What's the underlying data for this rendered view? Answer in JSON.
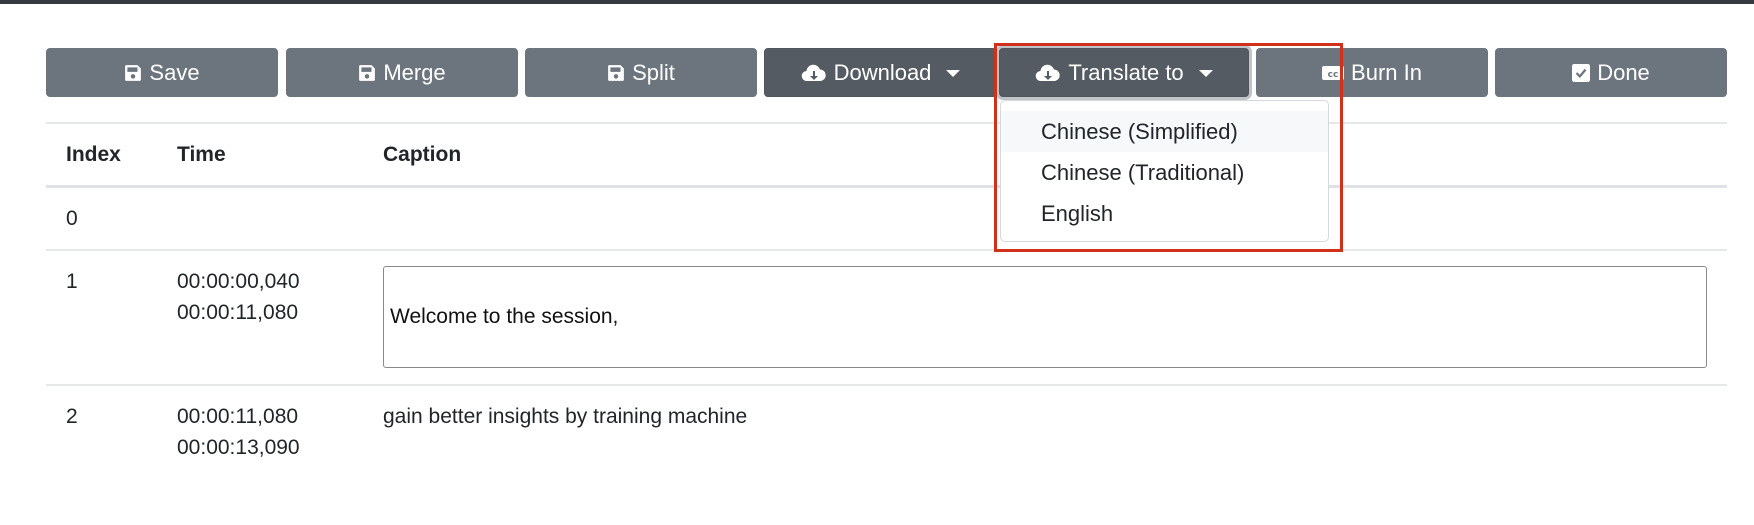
{
  "toolbar": {
    "buttons": [
      {
        "label": "Save",
        "icon": "save-icon"
      },
      {
        "label": "Merge",
        "icon": "save-icon"
      },
      {
        "label": "Split",
        "icon": "save-icon"
      },
      {
        "label": "Download",
        "icon": "cloud-download-icon",
        "dropdown": true
      },
      {
        "label": "Translate to",
        "icon": "cloud-download-icon",
        "dropdown": true,
        "open": true
      },
      {
        "label": "Burn In",
        "icon": "closed-captions-icon"
      },
      {
        "label": "Done",
        "icon": "check-square-icon"
      }
    ]
  },
  "translate_menu": {
    "options": [
      "Chinese (Simplified)",
      "Chinese (Traditional)",
      "English"
    ],
    "hovered": "Chinese (Simplified)"
  },
  "table": {
    "headers": {
      "index": "Index",
      "time": "Time",
      "caption": "Caption"
    },
    "rows": [
      {
        "index": "0",
        "start": "",
        "end": "",
        "caption": ""
      },
      {
        "index": "1",
        "start": "00:00:00,040",
        "end": "00:00:11,080",
        "caption": "Welcome to the session,",
        "editing": true
      },
      {
        "index": "2",
        "start": "00:00:11,080",
        "end": "00:00:13,090",
        "caption": "gain better insights by training machine"
      }
    ]
  },
  "colors": {
    "button": "#6c757d",
    "button_active": "#545b62",
    "highlight": "#d1301a",
    "topbar": "#343a40"
  }
}
